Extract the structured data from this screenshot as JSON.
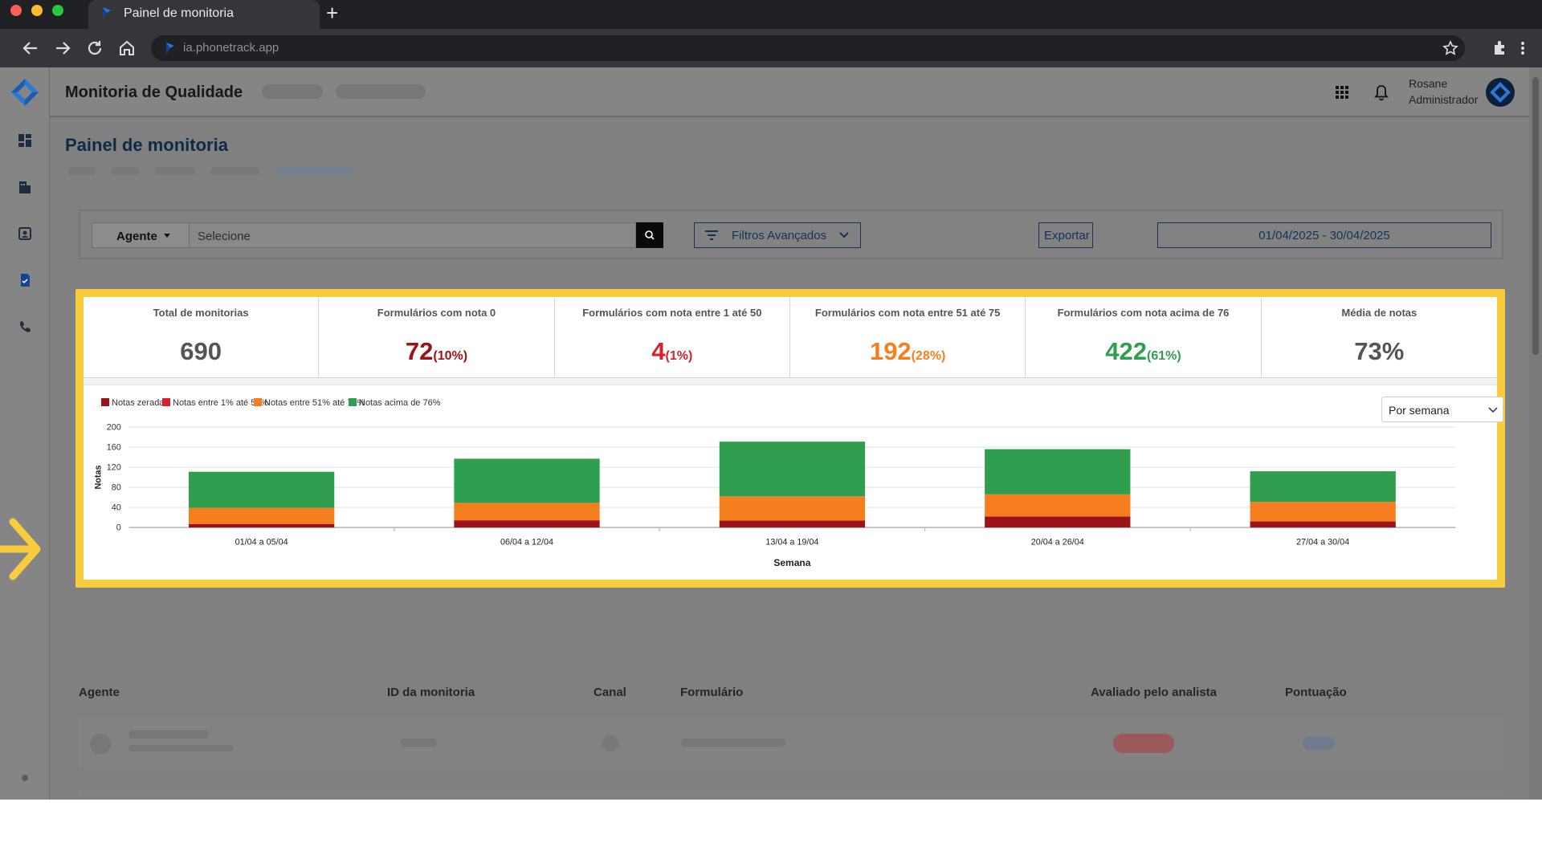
{
  "browser": {
    "tab_title": "Painel de monitoria",
    "new_tab": "+",
    "url": "ia.phonetrack.app"
  },
  "header": {
    "app_title": "Monitoria de Qualidade",
    "user_name": "Rosane",
    "user_role": "Administrador"
  },
  "page": {
    "title": "Painel de monitoria"
  },
  "filters": {
    "agent_label": "Agente",
    "agent_placeholder": "Selecione",
    "advanced_label": "Filtros Avançados",
    "export_label": "Exportar",
    "date_range": "01/04/2025 - 30/04/2025"
  },
  "stats": [
    {
      "label": "Total de monitorias",
      "value": "690",
      "pct": "",
      "color": "#555555"
    },
    {
      "label": "Formulários com nota 0",
      "value": "72",
      "pct": "(10%)",
      "color": "#9b1218"
    },
    {
      "label": "Formulários com nota entre 1 até 50",
      "value": "4",
      "pct": "(1%)",
      "color": "#d7202e"
    },
    {
      "label": "Formulários com nota entre 51 até 75",
      "value": "192",
      "pct": "(28%)",
      "color": "#f57f1e"
    },
    {
      "label": "Formulários com nota acima de 76",
      "value": "422",
      "pct": "(61%)",
      "color": "#2f9e4f"
    },
    {
      "label": "Média de notas",
      "value": "73%",
      "pct": "",
      "color": "#555555"
    }
  ],
  "period_select": "Por semana",
  "chart_data": {
    "type": "bar",
    "stacked": true,
    "categories": [
      "01/04 a 05/04",
      "06/04 a 12/04",
      "13/04 a 19/04",
      "20/04 a 26/04",
      "27/04 a 30/04"
    ],
    "series": [
      {
        "name": "Notas zeradas",
        "color": "#9b1218",
        "values": [
          7,
          14,
          14,
          22,
          12
        ]
      },
      {
        "name": "Notas entre 1% até 50%",
        "color": "#d7202e",
        "values": [
          0,
          1,
          0,
          0,
          0
        ]
      },
      {
        "name": "Notas entre 51% até 75%",
        "color": "#f57f1e",
        "values": [
          32,
          34,
          48,
          44,
          39
        ]
      },
      {
        "name": "Notas acima de 76%",
        "color": "#2f9e4f",
        "values": [
          72,
          88,
          109,
          90,
          61
        ]
      }
    ],
    "xlabel": "Semana",
    "ylabel": "Notas",
    "ylim": [
      0,
      200
    ],
    "yticks": [
      0,
      40,
      80,
      120,
      160,
      200
    ],
    "grid": true,
    "legend": "top-left"
  },
  "table": {
    "headers": [
      "Agente",
      "ID da monitoria",
      "Canal",
      "Formulário",
      "Avaliado pelo analista",
      "Pontuação"
    ]
  },
  "colors": {
    "highlight": "#f7cc3f",
    "brand": "#16325a"
  }
}
